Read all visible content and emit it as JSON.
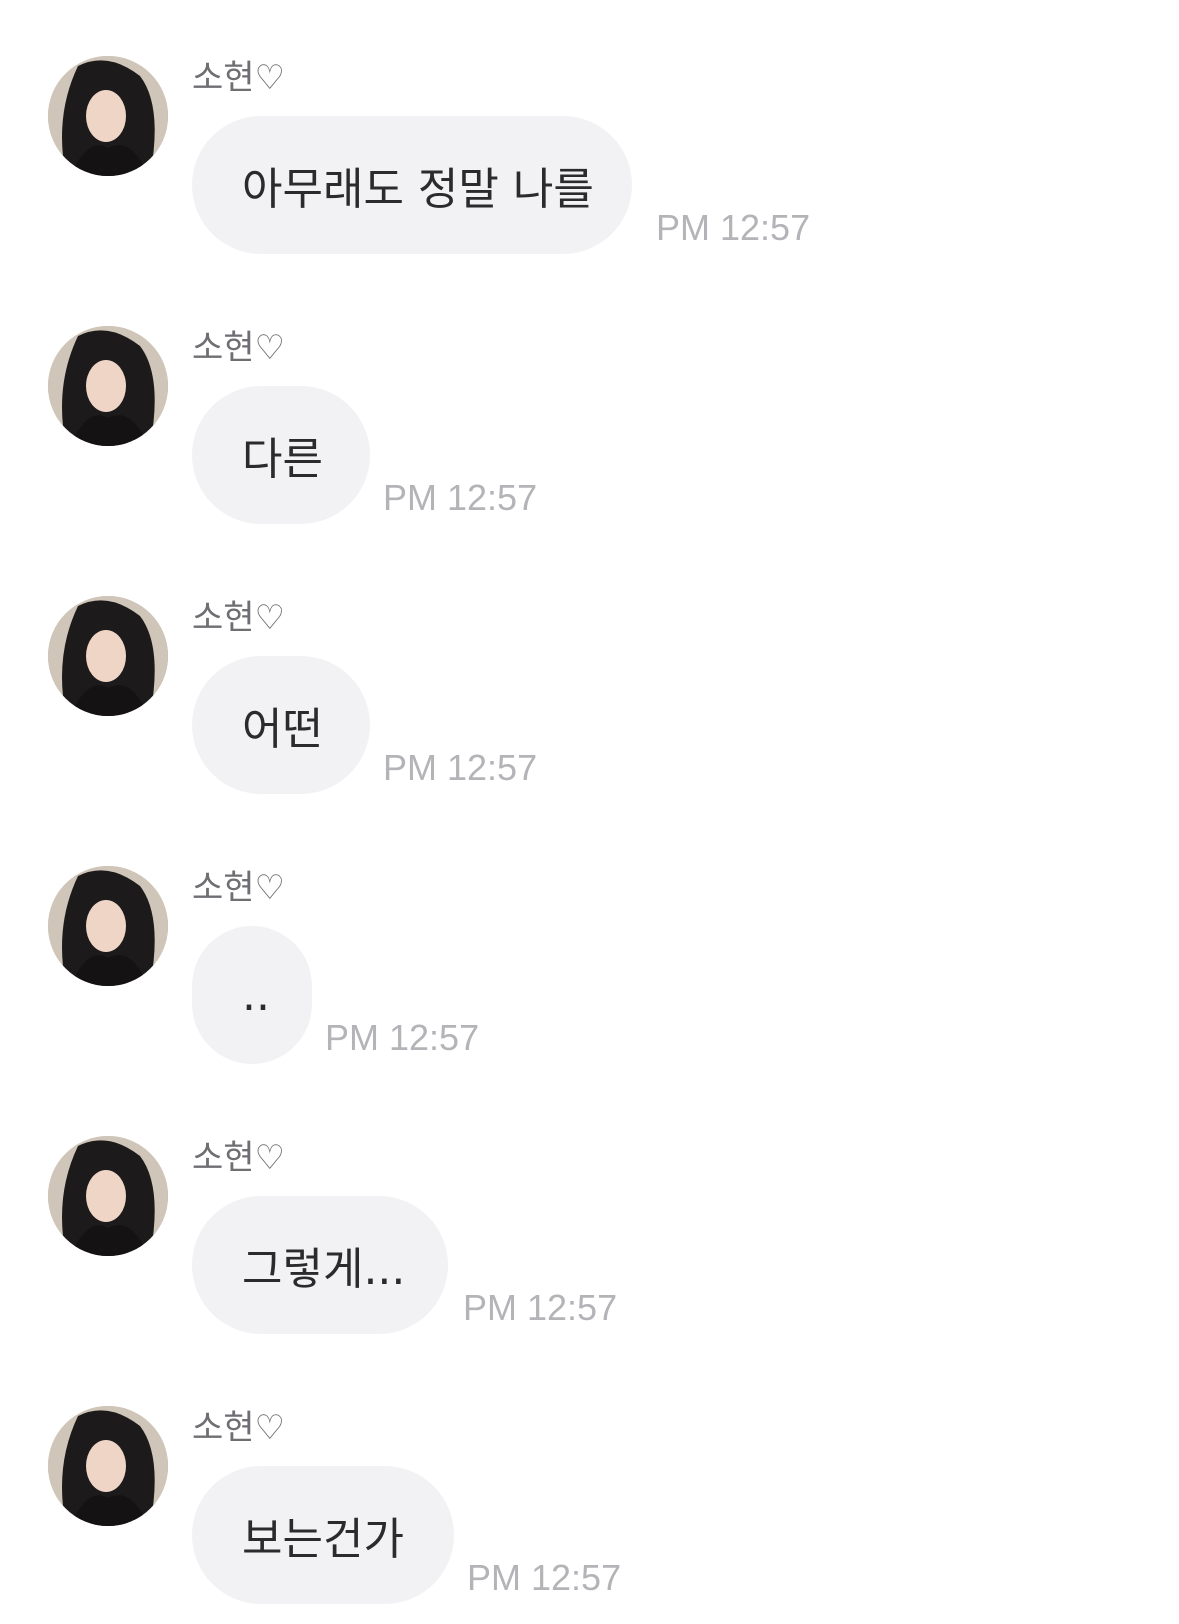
{
  "messages": [
    {
      "sender": "소현♡",
      "text": "아무래도 정말 나를",
      "time": "PM 12:57"
    },
    {
      "sender": "소현♡",
      "text": "다른",
      "time": "PM 12:57"
    },
    {
      "sender": "소현♡",
      "text": "어떤",
      "time": "PM 12:57"
    },
    {
      "sender": "소현♡",
      "text": "..",
      "time": "PM 12:57"
    },
    {
      "sender": "소현♡",
      "text": "그렇게...",
      "time": "PM 12:57"
    },
    {
      "sender": "소현♡",
      "text": "보는건가",
      "time": "PM 12:57"
    }
  ],
  "avatar_icon": "profile-photo",
  "colors": {
    "bubble": "#f2f2f5",
    "text": "#2b2b2b",
    "sender": "#6e6e73",
    "time": "#b4b4b8"
  }
}
